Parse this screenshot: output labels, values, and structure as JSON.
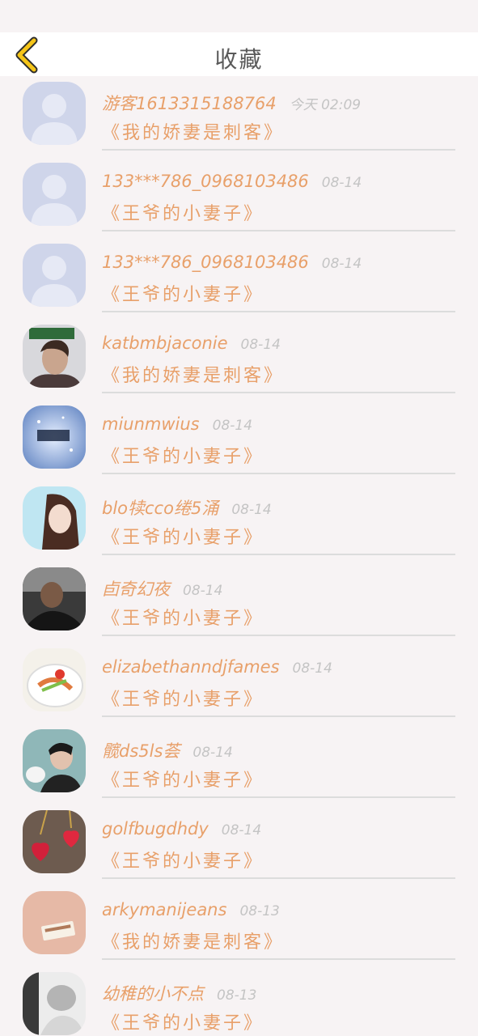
{
  "header": {
    "title": "收藏"
  },
  "items": [
    {
      "name": "游客1613315188764",
      "time": "今天 02:09",
      "book": "《我的娇妻是刺客》",
      "avatar": "default-avatar-icon"
    },
    {
      "name": "133***786_0968103486",
      "time": "08-14",
      "book": "《王爷的小妻子》",
      "avatar": "default-avatar-icon"
    },
    {
      "name": "133***786_0968103486",
      "time": "08-14",
      "book": "《王爷的小妻子》",
      "avatar": "default-avatar-icon"
    },
    {
      "name": "katbmbjaconie",
      "time": "08-14",
      "book": "《我的娇妻是刺客》",
      "avatar": "user-photo"
    },
    {
      "name": "miunmwius",
      "time": "08-14",
      "book": "《王爷的小妻子》",
      "avatar": "user-photo"
    },
    {
      "name": "blo犊cco绻5涌",
      "time": "08-14",
      "book": "《王爷的小妻子》",
      "avatar": "user-photo"
    },
    {
      "name": "卣奇幻夜",
      "time": "08-14",
      "book": "《王爷的小妻子》",
      "avatar": "user-photo"
    },
    {
      "name": "elizabethanndjfames",
      "time": "08-14",
      "book": "《王爷的小妻子》",
      "avatar": "user-photo"
    },
    {
      "name": "髋ds5ls荟",
      "time": "08-14",
      "book": "《王爷的小妻子》",
      "avatar": "user-photo"
    },
    {
      "name": "golfbugdhdy",
      "time": "08-14",
      "book": "《王爷的小妻子》",
      "avatar": "user-photo"
    },
    {
      "name": "arkymanijeans",
      "time": "08-13",
      "book": "《我的娇妻是刺客》",
      "avatar": "user-photo"
    },
    {
      "name": "幼稚的小不点",
      "time": "08-13",
      "book": "《王爷的小妻子》",
      "avatar": "user-photo"
    }
  ],
  "colors": {
    "accent": "#e8a06a",
    "back_arrow": "#f5c518",
    "time": "#c4c4c4",
    "background": "#f7f3f4"
  }
}
